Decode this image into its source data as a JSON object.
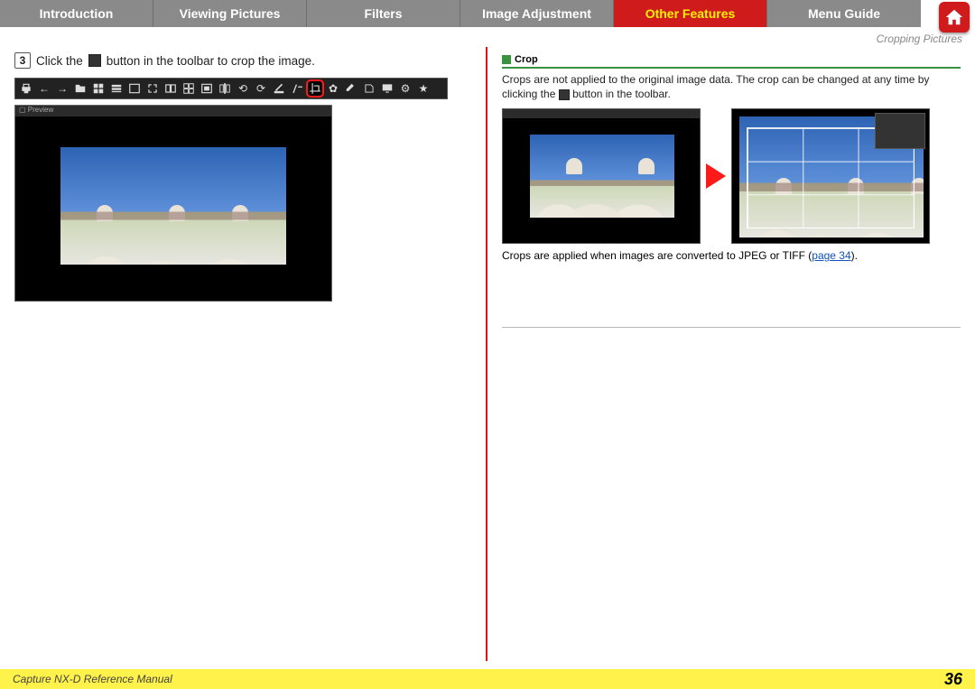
{
  "tabs": {
    "items": [
      "Introduction",
      "Viewing Pictures",
      "Filters",
      "Image Adjustment",
      "Other Features",
      "Menu Guide"
    ],
    "active_index": 4
  },
  "breadcrumb": "Cropping Pictures",
  "step": {
    "number": "3",
    "text_before": "Click the",
    "text_after": "button in the toolbar to crop the image."
  },
  "toolbar_icons": [
    "print",
    "back",
    "forward",
    "open",
    "grid",
    "thumb",
    "single",
    "fit",
    "two-up",
    "split4",
    "fit-win",
    "compare",
    "rotate",
    "rotate2",
    "straighten",
    "gray-point",
    "crop",
    "plugin",
    "retouch",
    "convert",
    "monitor",
    "prefs",
    "star"
  ],
  "note": {
    "title": "Crop",
    "body_before": "Crops are not applied to the original image data. The crop can be changed at any time by clicking the",
    "body_after": "button in the toolbar."
  },
  "apply_note": {
    "text": "Crops are applied when images are converted to JPEG or TIFF (",
    "link": "page 34",
    "close": ")."
  },
  "footer": {
    "title": "Capture NX-D Reference Manual",
    "page": "36"
  }
}
